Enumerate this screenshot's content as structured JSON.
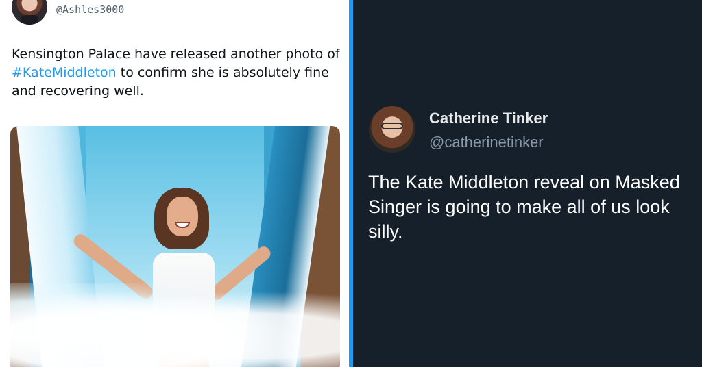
{
  "left_tweet": {
    "handle": "@Ashles3000",
    "text_before": "Kensington Palace have released another photo of ",
    "hashtag": "#KateMiddleton",
    "text_after": " to confirm she is absolutely fine and recovering well."
  },
  "right_tweet": {
    "display_name": "Catherine Tinker",
    "handle": "@catherinetinker",
    "text": "The Kate Middleton reveal on Masked Singer is going to make all of us look silly."
  },
  "colors": {
    "link": "#1d9bf0",
    "divider": "#1d9bf0",
    "dark_bg": "#15202b",
    "light_bg": "#ffffff"
  }
}
